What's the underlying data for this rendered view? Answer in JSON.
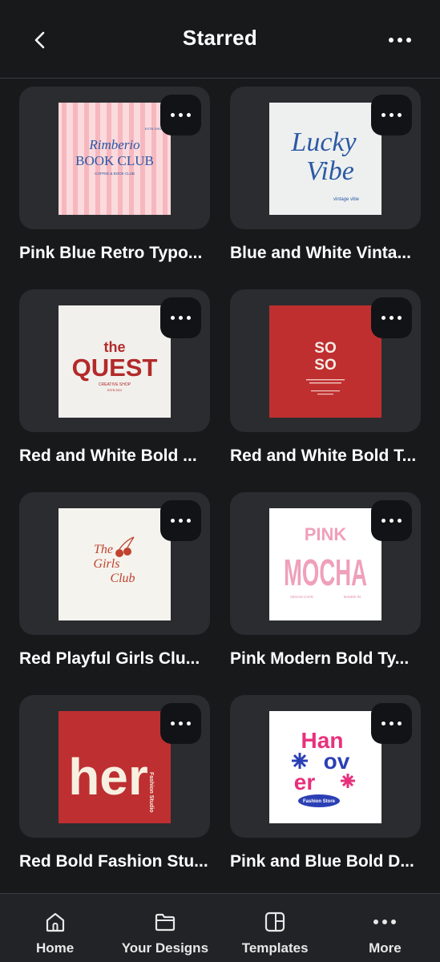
{
  "header": {
    "title": "Starred"
  },
  "colors": {
    "background": "#18191b",
    "card": "#2b2c30",
    "menu": "#121316"
  },
  "cards": [
    {
      "label": "Pink Blue Retro Typo...",
      "thumb": {
        "line1": "Rimberio",
        "line2": "BOOK CLUB",
        "tag": "ESTB 1991",
        "sub": "COFFEE & BOOK CLUB"
      }
    },
    {
      "label": "Blue and White Vinta...",
      "thumb": {
        "line1": "Lucky",
        "line2": "Vibe",
        "sub": "vintage vibe"
      }
    },
    {
      "label": "Red and White Bold ...",
      "thumb": {
        "line1": "the",
        "line2": "QUEST",
        "sub": "CREATIVE SHOP",
        "tag": "ESTB 2024"
      }
    },
    {
      "label": "Red and White Bold T...",
      "thumb": {
        "line1": "SO",
        "line2": "SO"
      }
    },
    {
      "label": "Red Playful Girls Clu...",
      "thumb": {
        "line1": "The",
        "line2": "Girls",
        "line3": "Club"
      }
    },
    {
      "label": "Pink Modern Bold Ty...",
      "thumb": {
        "line1": "PINK",
        "line2": "MOCHA",
        "left": "VEGAN CAFE",
        "right": "BAKED IN"
      }
    },
    {
      "label": "Red Bold Fashion Stu...",
      "thumb": {
        "line1": "her",
        "sub": "Fashion Studio"
      }
    },
    {
      "label": "Pink and Blue Bold D...",
      "thumb": {
        "line1": "Han",
        "line2": "ov",
        "line3": "er",
        "sub": "Fashion Store"
      }
    }
  ],
  "nav": [
    {
      "label": "Home",
      "icon": "home-icon"
    },
    {
      "label": "Your Designs",
      "icon": "folder-icon"
    },
    {
      "label": "Templates",
      "icon": "templates-icon"
    },
    {
      "label": "More",
      "icon": "more-icon"
    }
  ]
}
